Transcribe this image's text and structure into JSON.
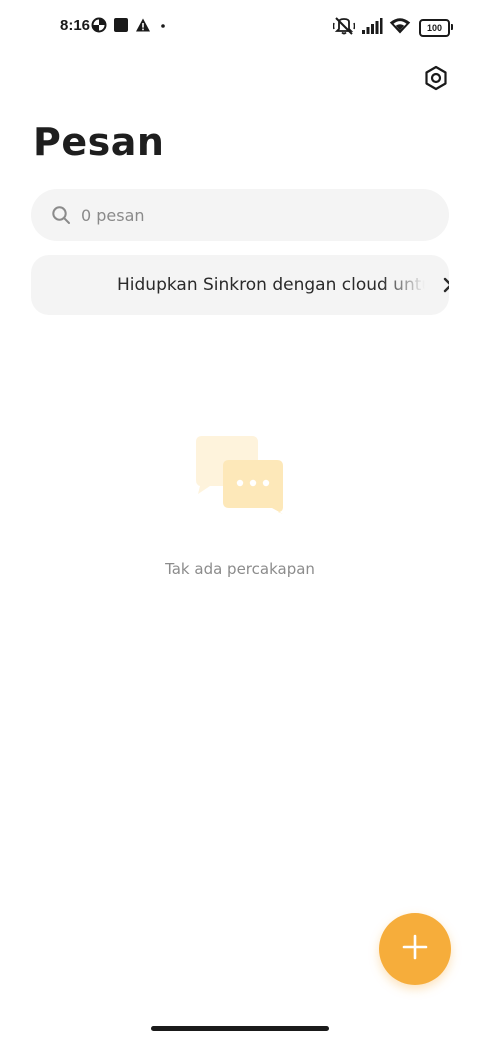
{
  "status_bar": {
    "time": "8:16",
    "battery_level": "100",
    "left_icons": [
      "data-saver-icon",
      "app-square-icon",
      "warning-icon",
      "dot-icon"
    ],
    "right_icons": [
      "vibrate-off-icon",
      "signal-icon",
      "wifi-icon",
      "battery-icon"
    ]
  },
  "header": {
    "title": "Pesan",
    "settings_icon": "settings-hex-icon"
  },
  "search": {
    "placeholder": "0 pesan",
    "value": ""
  },
  "sync_banner": {
    "text": "Hidupkan Sinkron dengan cloud untuk mencadangkan pesan"
  },
  "empty_state": {
    "text": "Tak ada percakapan",
    "icon": "chat-bubbles-icon"
  },
  "fab": {
    "icon": "plus-icon"
  },
  "colors": {
    "accent": "#f6ad3b",
    "surface": "#f4f4f4",
    "muted_text": "#8c8c8c",
    "illustration": "#fde8b9"
  }
}
